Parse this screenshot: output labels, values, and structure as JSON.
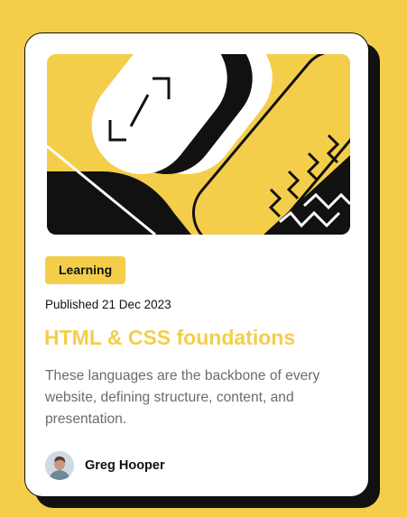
{
  "card": {
    "hero_alt": "illustration-article",
    "tag": "Learning",
    "published": "Published 21 Dec 2023",
    "title": "HTML & CSS foundations",
    "description": "These languages are the backbone of every website, defining structure, content, and presentation.",
    "author": {
      "name": "Greg Hooper"
    }
  },
  "colors": {
    "background": "#F4CE4B",
    "card": "#FFFFFF",
    "ink": "#111111",
    "accent": "#F4CE4B",
    "muted_text": "#6B6B6B"
  }
}
